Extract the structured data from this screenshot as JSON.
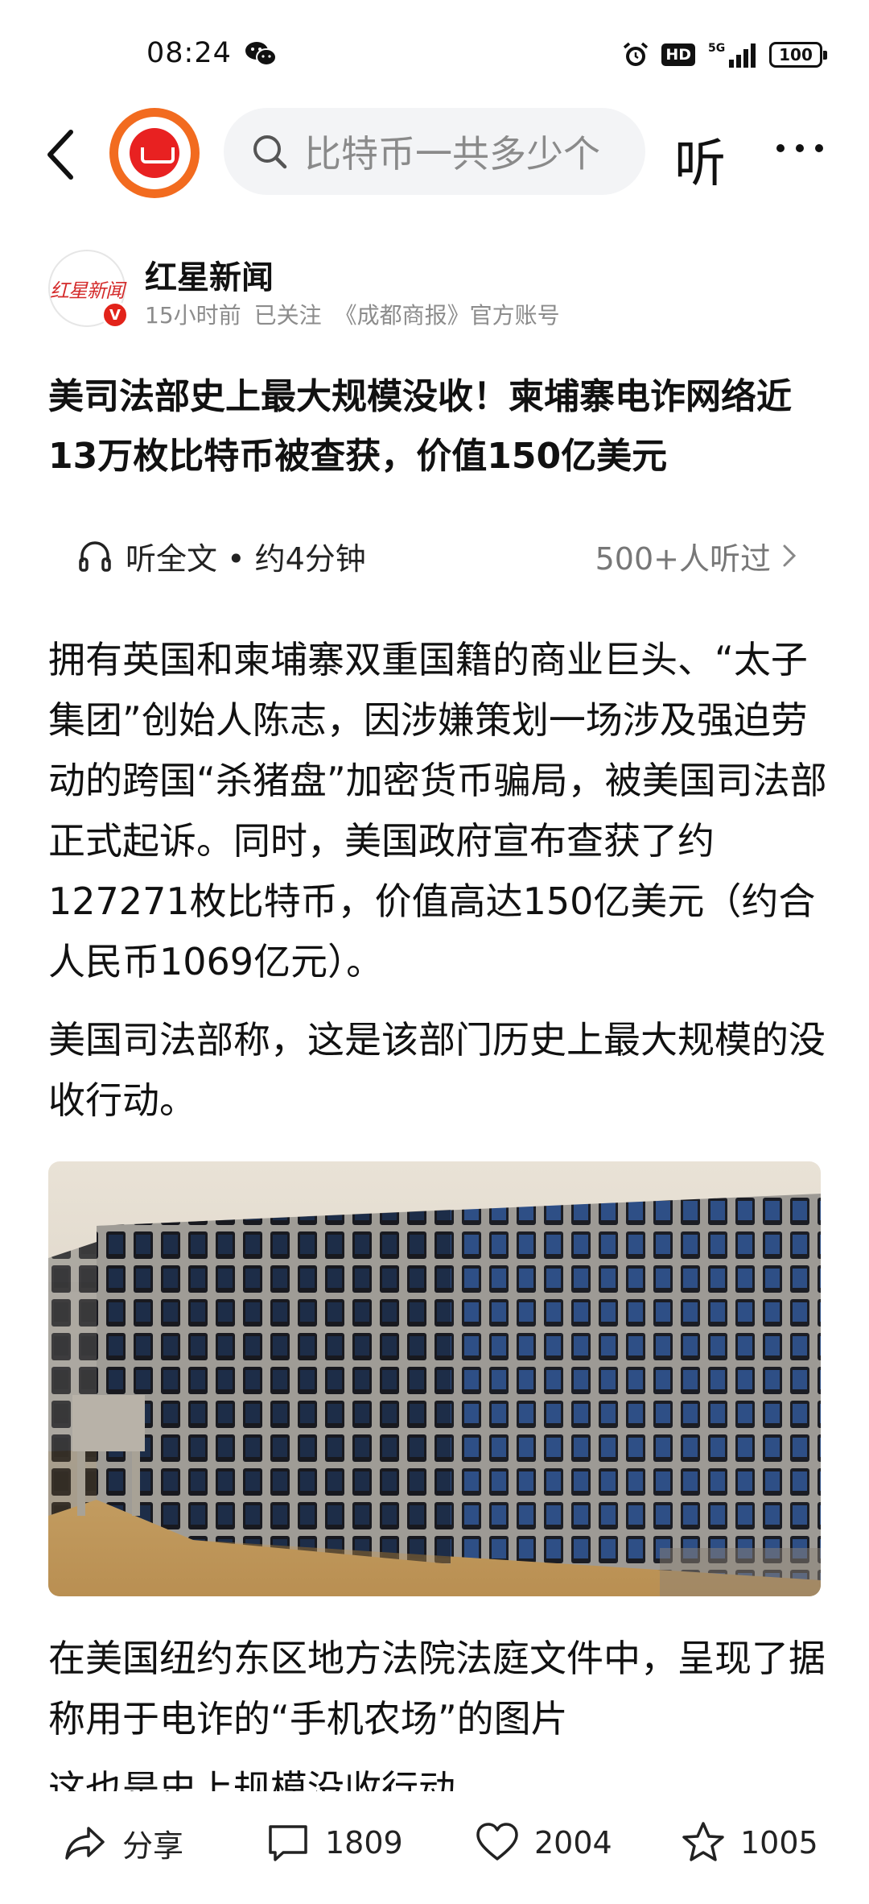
{
  "status_bar": {
    "time": "08:24",
    "network": "5G",
    "hd_label": "HD",
    "battery": "100"
  },
  "header": {
    "search_placeholder": "比特币一共多少个",
    "listen_label": "听"
  },
  "author": {
    "avatar_text": "红星新闻",
    "verify_mark": "V",
    "name": "红星新闻",
    "time_ago": "15小时前",
    "follow_status": "已关注",
    "account_desc": "《成都商报》官方账号"
  },
  "article": {
    "title": "美司法部史上最大规模没收！柬埔寨电诈网络近13万枚比特币被查获，价值150亿美元",
    "listen_full": "听全文 • 约4分钟",
    "listen_count": "500+人听过",
    "paragraph1": "拥有英国和柬埔寨双重国籍的商业巨头、“太子集团”创始人陈志，因涉嫌策划一场涉及强迫劳动的跨国“杀猪盘”加密货币骗局，被美国司法部正式起诉。同时，美国政府宣布查获了约127271枚比特币，价值高达150亿美元（约合人民币1069亿元）。",
    "paragraph2": "美国司法部称，这是该部门历史上最大规模的没收行动。",
    "caption": "在美国纽约东区地方法院法庭文件中，呈现了据称用于电诈的“手机农场”的图片",
    "cut_line": "这也是史上规模没收行动"
  },
  "bottom_bar": {
    "share_label": "分享",
    "comment_count": "1809",
    "like_count": "2004",
    "favorite_count": "1005"
  },
  "colors": {
    "accent_red": "#e2231a",
    "logo_orange": "#f26b1f",
    "search_bg": "#f3f4f6"
  }
}
